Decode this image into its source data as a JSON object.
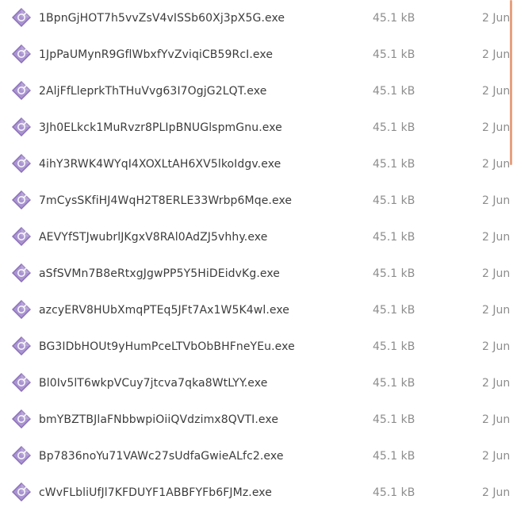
{
  "files": [
    {
      "name": "1BpnGjHOT7h5vvZsV4vISSb60Xj3pX5G.exe",
      "size": "45.1 kB",
      "modified": "2 Jun",
      "icon": "executable-icon"
    },
    {
      "name": "1JpPaUMynR9GflWbxfYvZviqiCB59RcI.exe",
      "size": "45.1 kB",
      "modified": "2 Jun",
      "icon": "executable-icon"
    },
    {
      "name": "2AljFfLleprkThTHuVvg63I7OgjG2LQT.exe",
      "size": "45.1 kB",
      "modified": "2 Jun",
      "icon": "executable-icon"
    },
    {
      "name": "3Jh0ELkck1MuRvzr8PLIpBNUGlspmGnu.exe",
      "size": "45.1 kB",
      "modified": "2 Jun",
      "icon": "executable-icon"
    },
    {
      "name": "4ihY3RWK4WYqI4XOXLtAH6XV5lkoIdgv.exe",
      "size": "45.1 kB",
      "modified": "2 Jun",
      "icon": "executable-icon"
    },
    {
      "name": "7mCysSKfiHJ4WqH2T8ERLE33Wrbp6Mqe.exe",
      "size": "45.1 kB",
      "modified": "2 Jun",
      "icon": "executable-icon"
    },
    {
      "name": "AEVYfSTJwubrlJKgxV8RAl0AdZJ5vhhy.exe",
      "size": "45.1 kB",
      "modified": "2 Jun",
      "icon": "executable-icon"
    },
    {
      "name": "aSfSVMn7B8eRtxgJgwPP5Y5HiDEidvKg.exe",
      "size": "45.1 kB",
      "modified": "2 Jun",
      "icon": "executable-icon"
    },
    {
      "name": "azcyERV8HUbXmqPTEq5JFt7Ax1W5K4wl.exe",
      "size": "45.1 kB",
      "modified": "2 Jun",
      "icon": "executable-icon"
    },
    {
      "name": "BG3IDbHOUt9yHumPceLTVbObBHFneYEu.exe",
      "size": "45.1 kB",
      "modified": "2 Jun",
      "icon": "executable-icon"
    },
    {
      "name": "Bl0Iv5lT6wkpVCuy7jtcva7qka8WtLYY.exe",
      "size": "45.1 kB",
      "modified": "2 Jun",
      "icon": "executable-icon"
    },
    {
      "name": "bmYBZTBJlaFNbbwpiOiiQVdzimx8QVTI.exe",
      "size": "45.1 kB",
      "modified": "2 Jun",
      "icon": "executable-icon"
    },
    {
      "name": "Bp7836noYu71VAWc27sUdfaGwieALfc2.exe",
      "size": "45.1 kB",
      "modified": "2 Jun",
      "icon": "executable-icon"
    },
    {
      "name": "cWvFLbliUfJl7KFDUYF1ABBFYFb6FJMz.exe",
      "size": "45.1 kB",
      "modified": "2 Jun",
      "icon": "executable-icon"
    }
  ],
  "colors": {
    "icon_body": "#8a6fb8",
    "icon_light": "#c5b3e3",
    "scrollbar_thumb": "#e9a07e",
    "name_text": "#3c3c3c",
    "meta_text": "#8d8d8d"
  }
}
